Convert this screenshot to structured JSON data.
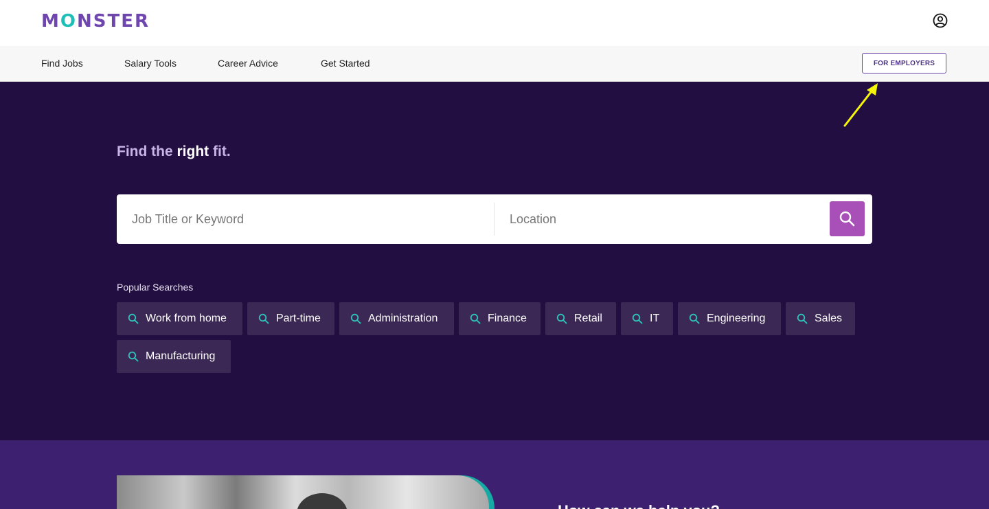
{
  "header": {
    "logo": {
      "part1": "M",
      "o": "O",
      "part2": "NSTER"
    },
    "account_icon": "user-circle-icon"
  },
  "nav": {
    "items": [
      {
        "label": "Find Jobs"
      },
      {
        "label": "Salary Tools"
      },
      {
        "label": "Career Advice"
      },
      {
        "label": "Get Started"
      }
    ],
    "employers_label": "FOR EMPLOYERS"
  },
  "hero": {
    "headline_prefix": "Find the",
    "headline_bold": "right",
    "headline_suffix": "fit.",
    "search": {
      "keyword_placeholder": "Job Title or Keyword",
      "location_placeholder": "Location",
      "button_icon": "search-icon"
    },
    "popular_label": "Popular Searches",
    "chips": [
      {
        "label": "Work from home"
      },
      {
        "label": "Part-time"
      },
      {
        "label": "Administration"
      },
      {
        "label": "Finance"
      },
      {
        "label": "Retail"
      },
      {
        "label": "IT"
      },
      {
        "label": "Engineering"
      },
      {
        "label": "Sales"
      },
      {
        "label": "Manufacturing"
      }
    ]
  },
  "section2": {
    "title": "How can we help you?"
  },
  "colors": {
    "brand_purple": "#6e46ae",
    "brand_teal": "#1fbfb8",
    "hero_bg": "#220e40",
    "chip_bg": "#3b2855",
    "search_button": "#a94fb8",
    "annotation_arrow": "#f5f50a"
  }
}
